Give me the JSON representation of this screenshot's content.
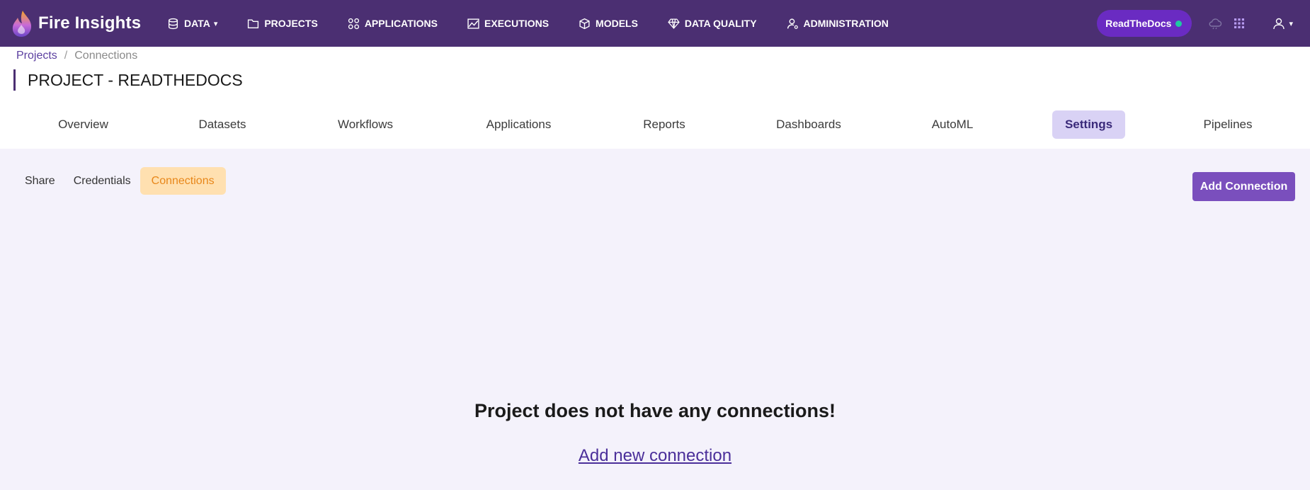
{
  "app": {
    "name": "Fire Insights"
  },
  "nav": {
    "items": [
      {
        "label": "DATA",
        "icon": "database-icon",
        "has_caret": true
      },
      {
        "label": "PROJECTS",
        "icon": "folder-icon"
      },
      {
        "label": "APPLICATIONS",
        "icon": "apps-grid-icon"
      },
      {
        "label": "EXECUTIONS",
        "icon": "chart-area-icon"
      },
      {
        "label": "MODELS",
        "icon": "cube-icon"
      },
      {
        "label": "DATA QUALITY",
        "icon": "diamond-icon"
      },
      {
        "label": "ADMINISTRATION",
        "icon": "user-cog-icon"
      }
    ],
    "caret": "▾",
    "org_badge": "ReadTheDocs",
    "right_icons": [
      "cloud-icon",
      "grid-dots-icon",
      "user-icon"
    ]
  },
  "breadcrumb": {
    "root": "Projects",
    "separator": "/",
    "current": "Connections"
  },
  "page": {
    "title": "PROJECT - READTHEDOCS"
  },
  "tabs": [
    {
      "label": "Overview"
    },
    {
      "label": "Datasets"
    },
    {
      "label": "Workflows"
    },
    {
      "label": "Applications"
    },
    {
      "label": "Reports"
    },
    {
      "label": "Dashboards"
    },
    {
      "label": "AutoML"
    },
    {
      "label": "Settings",
      "active": true
    },
    {
      "label": "Pipelines"
    }
  ],
  "subtabs": [
    {
      "label": "Share"
    },
    {
      "label": "Credentials"
    },
    {
      "label": "Connections",
      "active": true
    }
  ],
  "actions": {
    "add_connection": "Add Connection"
  },
  "empty_state": {
    "title": "Project does not have any connections!",
    "link": "Add new connection"
  },
  "colors": {
    "navbar": "#4b2f72",
    "accent": "#7a4fbd",
    "active_tab": "#d9d2f5",
    "active_subtab": "#ffe0b0",
    "status_dot": "#1ec9a2"
  }
}
